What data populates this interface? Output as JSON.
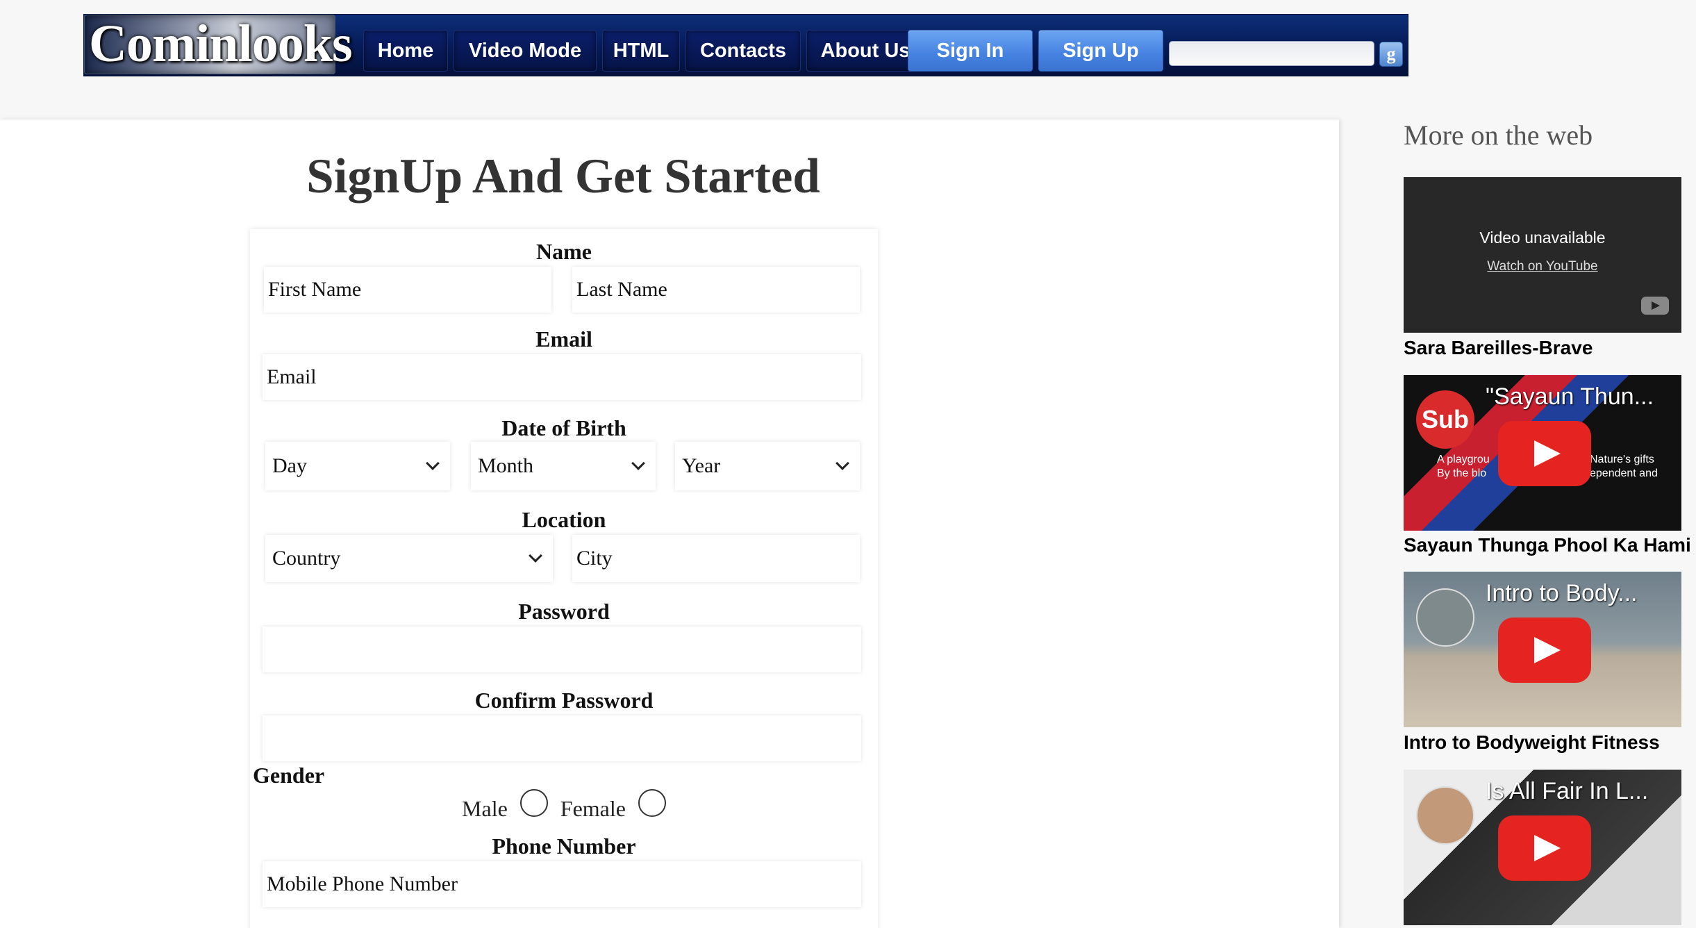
{
  "header": {
    "logo_text": "Cominlooks",
    "nav": [
      {
        "label": "Home"
      },
      {
        "label": "Video Mode"
      },
      {
        "label": "HTML"
      },
      {
        "label": "Contacts"
      },
      {
        "label": "About Us"
      }
    ],
    "sign_in": "Sign In",
    "sign_up": "Sign Up",
    "search_value": "",
    "search_button": "g"
  },
  "form": {
    "title": "SignUp And Get Started",
    "name_label": "Name",
    "first_name_placeholder": "First Name",
    "last_name_placeholder": "Last Name",
    "email_label": "Email",
    "email_placeholder": "Email",
    "dob_label": "Date of Birth",
    "day": "Day",
    "month": "Month",
    "year": "Year",
    "location_label": "Location",
    "country": "Country",
    "city_placeholder": "City",
    "password_label": "Password",
    "confirm_password_label": "Confirm Password",
    "gender_label": "Gender",
    "male": "Male",
    "female": "Female",
    "phone_label": "Phone Number",
    "phone_placeholder": "Mobile Phone Number"
  },
  "sidebar": {
    "title": "More on the web",
    "videos": [
      {
        "caption": "Sara Bareilles-Brave",
        "overlay": "Video unavailable",
        "link": "Watch on YouTube"
      },
      {
        "caption": "Sayaun Thunga Phool Ka Hami",
        "overlay_title": "\"Sayaun Thun...",
        "badge": "Sub",
        "text_left_1": "A playgrou",
        "text_left_2": "By the blo",
        "text_right_1": "Nature's gifts",
        "text_right_2": "ependent and"
      },
      {
        "caption": "Intro to Bodyweight Fitness",
        "overlay_title": "Intro to Body..."
      },
      {
        "caption": "",
        "overlay_title": "Is All Fair In L..."
      }
    ]
  },
  "colors": {
    "nav_dark": "#061a55",
    "nav_accent": "#4582e0",
    "youtube_red": "#e52421"
  }
}
